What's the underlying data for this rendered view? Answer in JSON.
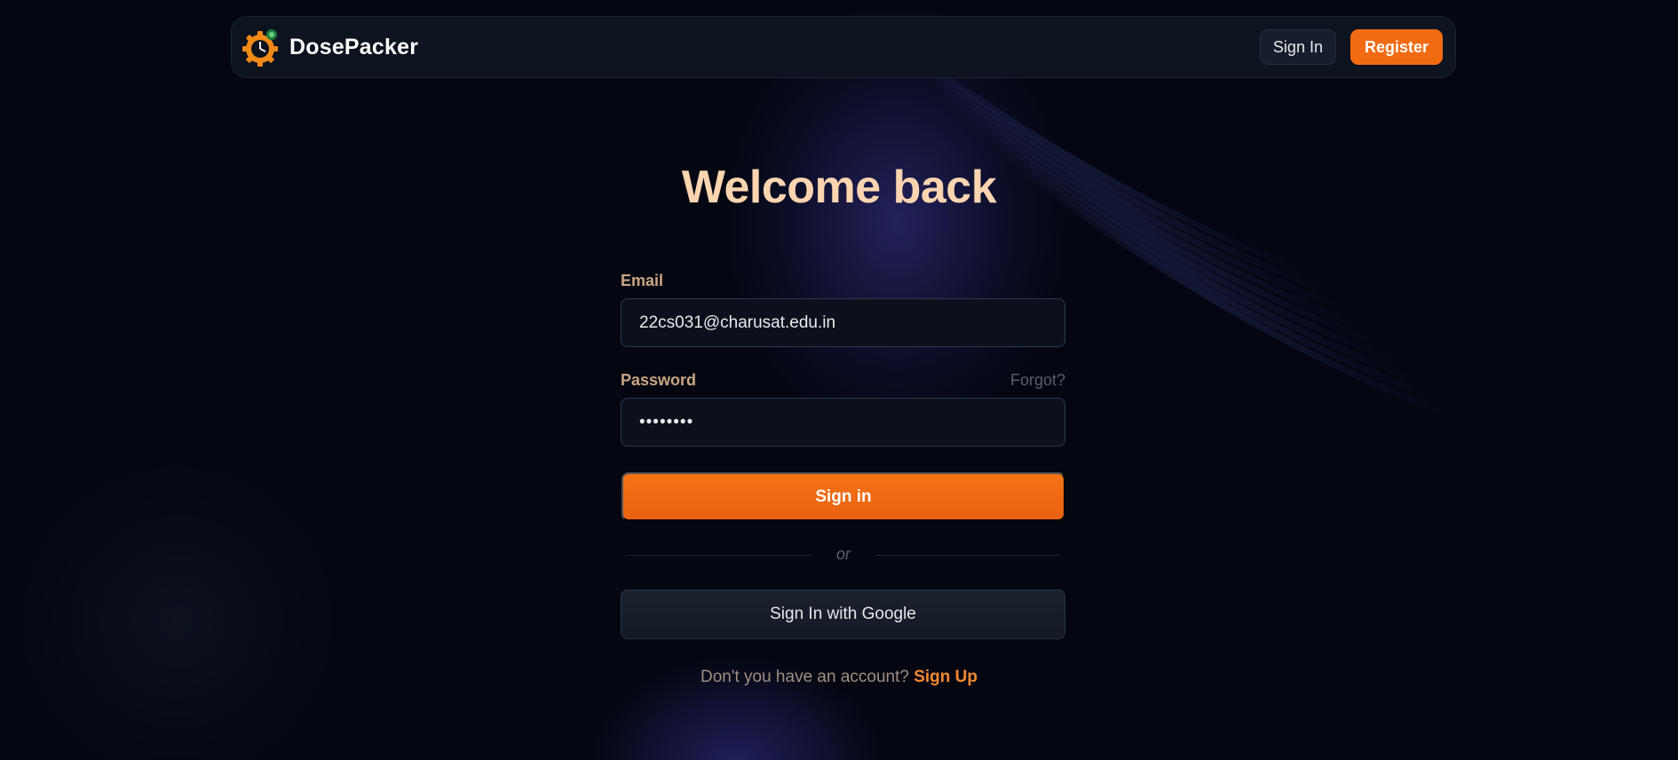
{
  "navbar": {
    "brand_name": "DosePacker",
    "sign_in_label": "Sign In",
    "register_label": "Register"
  },
  "form": {
    "title": "Welcome back",
    "email_label": "Email",
    "email_value": "22cs031@charusat.edu.in",
    "password_label": "Password",
    "forgot_label": "Forgot?",
    "password_value": "••••••••",
    "submit_label": "Sign in",
    "divider_text": "or",
    "google_label": "Sign In with Google",
    "signup_prompt": "Don't you have an account?",
    "signup_link": "Sign Up"
  },
  "colors": {
    "accent": "#f26b12",
    "title": "#fcd5b0",
    "label": "#c8a583",
    "background": "#040712"
  }
}
